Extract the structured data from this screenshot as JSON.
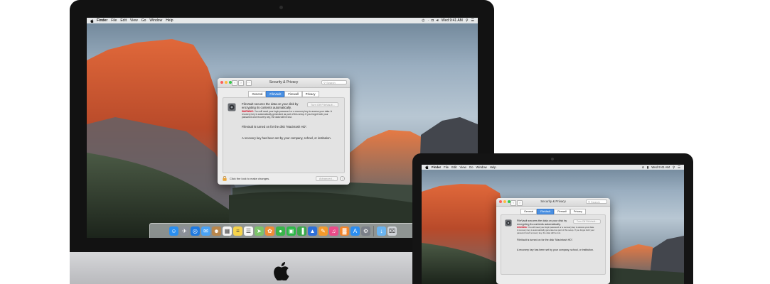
{
  "menubar": {
    "items": [
      "Finder",
      "File",
      "Edit",
      "View",
      "Go",
      "Window",
      "Help"
    ],
    "clock": "Wed 9:41 AM"
  },
  "window": {
    "title": "Security & Privacy",
    "search_placeholder": "Search",
    "tabs": [
      "General",
      "FileVault",
      "Firewall",
      "Privacy"
    ],
    "selected_tab": "FileVault",
    "filevault_desc": "FileVault secures the data on your disk by encrypting its contents automatically.",
    "turn_off_button": "Turn Off FileVault...",
    "warning_label": "WARNING:",
    "warning_text": "You will need your login password or a recovery key to access your data. A recovery key is automatically generated as part of this setup. If you forget both your password and recovery key, the data will be lost.",
    "status_on": "FileVault is turned on for the disk “Macintosh HD”.",
    "status_recovery": "A recovery key has been set by your company, school, or institution.",
    "lock_text": "Click the lock to make changes.",
    "advanced_button": "Advanced...",
    "help_symbol": "?"
  },
  "dock": {
    "apps": [
      {
        "name": "Finder",
        "color": "#2a8ff0",
        "glyph": "☺"
      },
      {
        "name": "Launchpad",
        "color": "#8a8f98",
        "glyph": "✈"
      },
      {
        "name": "Safari",
        "color": "#1f7ae0",
        "glyph": "◎"
      },
      {
        "name": "Mail",
        "color": "#4aa3f5",
        "glyph": "✉"
      },
      {
        "name": "Contacts",
        "color": "#b8864b",
        "glyph": "☻"
      },
      {
        "name": "Calendar",
        "color": "#f4f4f4",
        "glyph": "▦"
      },
      {
        "name": "Notes",
        "color": "#f5d34a",
        "glyph": "≡"
      },
      {
        "name": "Reminders",
        "color": "#f7f7f7",
        "glyph": "☰"
      },
      {
        "name": "Maps",
        "color": "#7cc46a",
        "glyph": "➤"
      },
      {
        "name": "Photos",
        "color": "#f08c36",
        "glyph": "✿"
      },
      {
        "name": "Messages",
        "color": "#39b54a",
        "glyph": "●"
      },
      {
        "name": "FaceTime",
        "color": "#2fb84a",
        "glyph": "▣"
      },
      {
        "name": "Numbers",
        "color": "#3aa84a",
        "glyph": "▐"
      },
      {
        "name": "Keynote",
        "color": "#2e6fd8",
        "glyph": "▲"
      },
      {
        "name": "Pages",
        "color": "#f39a2c",
        "glyph": "✎"
      },
      {
        "name": "iTunes",
        "color": "#ea4c89",
        "glyph": "♫"
      },
      {
        "name": "iBooks",
        "color": "#f2852b",
        "glyph": "▓"
      },
      {
        "name": "App Store",
        "color": "#2c8ef0",
        "glyph": "A"
      },
      {
        "name": "System Preferences",
        "color": "#7a7f88",
        "glyph": "⚙"
      }
    ],
    "folders": [
      {
        "name": "Downloads",
        "color": "#6ab4f0",
        "glyph": "↓"
      },
      {
        "name": "Trash",
        "color": "#cfd3d8",
        "glyph": "⌧"
      }
    ]
  },
  "colors": {
    "selected_tab": "#4a90e2",
    "warning": "#d0021b",
    "close": "#fc605b",
    "minimize": "#fdbc40",
    "zoom": "#34c84a"
  }
}
